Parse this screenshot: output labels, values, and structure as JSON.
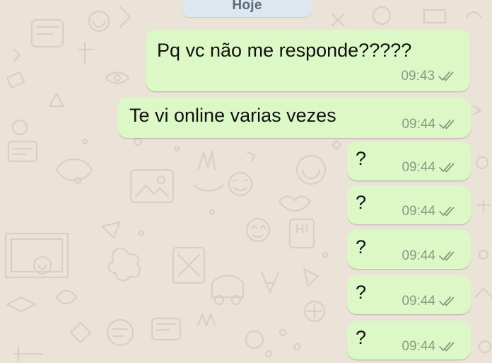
{
  "date_label": "Hoje",
  "messages": [
    {
      "text": "Pq vc não me responde?????",
      "time": "09:43",
      "status": "read-ticks"
    },
    {
      "text": "Te vi online varias vezes",
      "time": "09:44",
      "status": "read-ticks"
    },
    {
      "text": "?",
      "time": "09:44",
      "status": "read-ticks"
    },
    {
      "text": "?",
      "time": "09:44",
      "status": "read-ticks"
    },
    {
      "text": "?",
      "time": "09:44",
      "status": "read-ticks"
    },
    {
      "text": "?",
      "time": "09:44",
      "status": "read-ticks"
    },
    {
      "text": "?",
      "time": "09:44",
      "status": "read-ticks"
    }
  ],
  "colors": {
    "background": "#ebe3d8",
    "outgoing_bubble": "#dcf8c6",
    "date_pill": "#dde7ef",
    "ticks": "#8a9a83"
  }
}
